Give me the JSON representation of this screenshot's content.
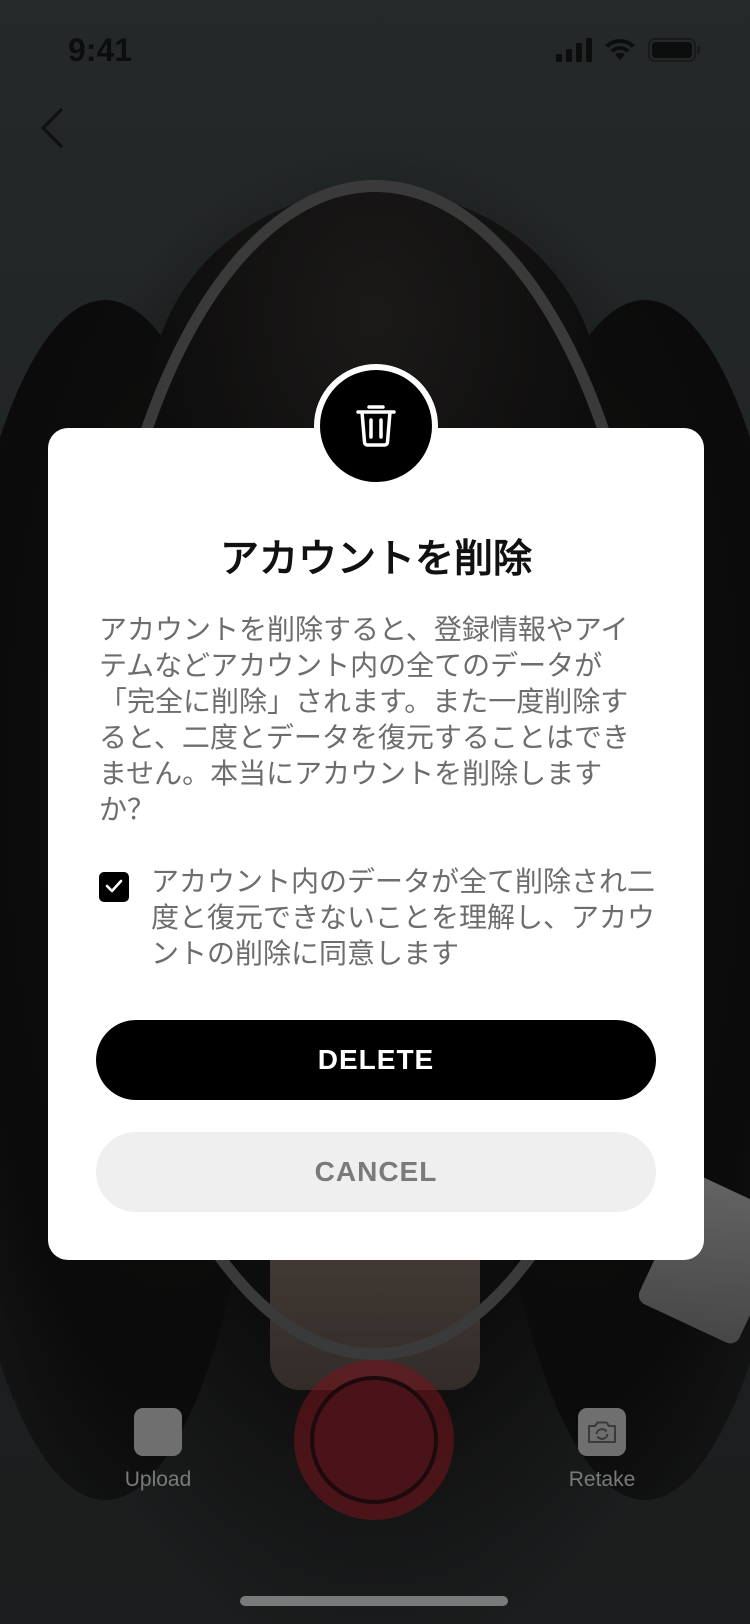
{
  "status_bar": {
    "time": "9:41"
  },
  "camera": {
    "upload_label": "Upload",
    "retake_label": "Retake",
    "shutter_color": "#4a1219"
  },
  "modal": {
    "title": "アカウントを削除",
    "body": "アカウントを削除すると、登録情報やアイテムなどアカウント内の全てのデータが「完全に削除」されます。また一度削除すると、二度とデータを復元することはできません。本当にアカウントを削除しますか？",
    "consent_text": "アカウント内のデータが全て削除され二度と復元できないことを理解し、アカウントの削除に同意します",
    "consent_checked": true,
    "delete_label": "DELETE",
    "cancel_label": "CANCEL",
    "icon": "trash-icon"
  },
  "colors": {
    "primary": "#000000",
    "modal_background": "#ffffff",
    "cancel_background": "#efefef",
    "body_text": "#6d6d6d"
  }
}
